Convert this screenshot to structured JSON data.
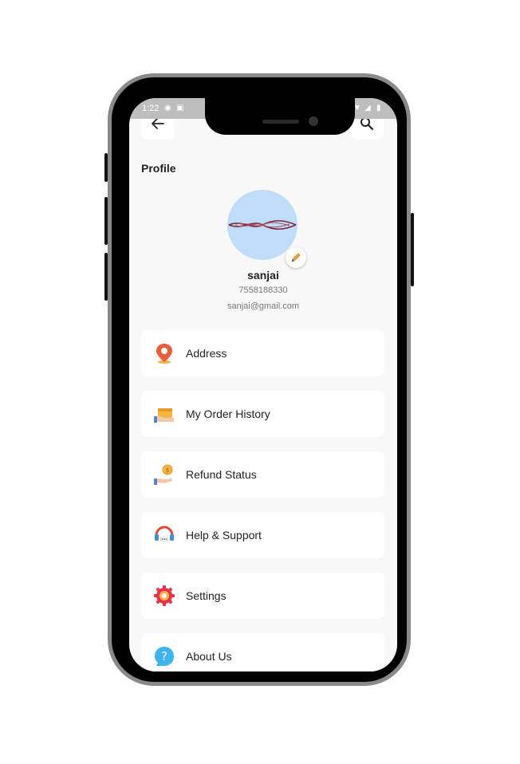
{
  "status_bar": {
    "time": "1:22"
  },
  "header": {
    "title": "Profile"
  },
  "profile": {
    "name": "sanjai",
    "phone": "7558188330",
    "email": "sanjai@gmail.com"
  },
  "menu": [
    {
      "label": "Address",
      "icon": "location-pin-icon"
    },
    {
      "label": "My Order History",
      "icon": "order-box-icon"
    },
    {
      "label": "Refund Status",
      "icon": "refund-coin-icon"
    },
    {
      "label": "Help & Support",
      "icon": "headset-icon"
    },
    {
      "label": "Settings",
      "icon": "gear-icon"
    },
    {
      "label": "About Us",
      "icon": "question-icon"
    }
  ],
  "colors": {
    "screen_bg": "#f8f8f8",
    "avatar_bg": "#bfdcf8",
    "status_bar": "#bdbdbd",
    "phone_frame": "#8a8a8a"
  }
}
